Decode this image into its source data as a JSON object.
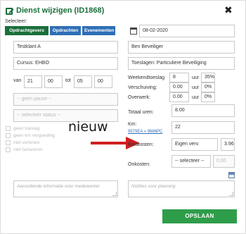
{
  "dialog": {
    "title": "Dienst wijzigen (ID1868)",
    "close_symbol": "✖",
    "selecteer_label": "Selecteer:",
    "select_buttons": [
      {
        "label": "Opdrachtgevers",
        "color": "#1a6f3a"
      },
      {
        "label": "Opdrachten",
        "color": "#2f6fb5"
      },
      {
        "label": "Evenementen",
        "color": "#2f6fb5"
      }
    ]
  },
  "left": {
    "klant": "Testklant A",
    "cursus": "Cursus: EHBO",
    "van_label": "van",
    "van_hour": "21",
    "van_min": "00",
    "tot_label": "tot",
    "tot_hour": "05",
    "tot_min": "00",
    "pauze_placeholder": "-- geen pauze --",
    "status_placeholder": "-- selecteer status --",
    "checkboxes": [
      "geen toeslag",
      "geen km vergoeding",
      "niet verlonen",
      "niet factureren"
    ],
    "nieuw_annotation": "nieuw",
    "notes_placeholder": "Aanvullende informatie voor medewerker"
  },
  "right": {
    "date": "08-02-2020",
    "beveiliger": "Ben Beveiliger",
    "toeslagen": "Toeslagen: Particuliere Beveiliging",
    "weekend_label": "Weekendtoeslag",
    "weekend_val": "8",
    "weekend_unit": "uur",
    "weekend_pct": "35%",
    "verschuiving_label": "Verschuiving:",
    "verschuiving_val": "0.00",
    "verschuiving_unit": "uur",
    "verschuiving_pct": "0%",
    "overwerk_label": "Overwerk:",
    "overwerk_val": "0.00",
    "overwerk_unit": "uur",
    "overwerk_pct": "0%",
    "totaal_label": "Totaal uren:",
    "totaal_val": "8.00",
    "km_label": "Km:",
    "km_link": "9579EA » 9686PC",
    "km_val": "22",
    "reiskosten_label": "Reiskosten:",
    "reiskosten_type": "Eigen verv.",
    "reiskosten_val": "3.96",
    "onkosten_label": "Onkosten:",
    "onkosten_add": "+",
    "onkosten_select": "-- selecteer --",
    "onkosten_val": "0.00",
    "planning_placeholder": "Notities voor planning",
    "save_label": "OPSLAAN"
  }
}
